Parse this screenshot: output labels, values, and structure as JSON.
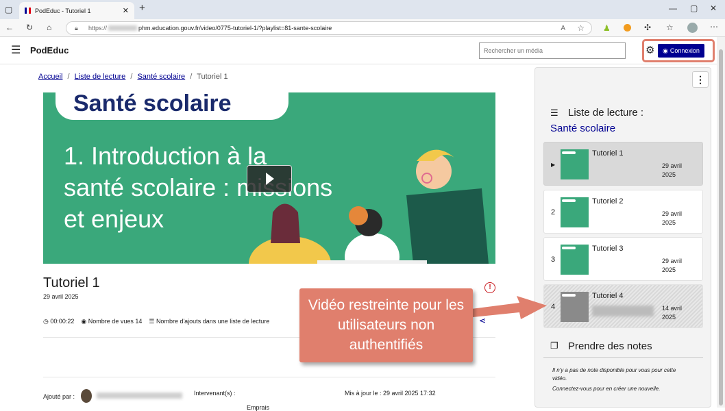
{
  "browser": {
    "tab_title": "PodEduc - Tutoriel 1",
    "url_prefix": "https://",
    "url_main": "phm.education.gouv.fr/video/0775-tutoriel-1/?playlist=81-sante-scolaire"
  },
  "header": {
    "logo": "PodEduc",
    "search_placeholder": "Rechercher un média",
    "login_label": "Connexion"
  },
  "breadcrumb": {
    "home": "Accueil",
    "playlists": "Liste de lecture",
    "playlist": "Santé scolaire",
    "current": "Tutoriel 1"
  },
  "video_slide": {
    "badge": "Santé scolaire",
    "line1": "1. Introduction à la",
    "line2": "santé scolaire : missions",
    "line3": "et enjeux"
  },
  "video": {
    "title": "Tutoriel 1",
    "date": "29 avril 2025",
    "duration": "00:00:22",
    "views": "Nombre de vues 14",
    "playlist_adds": "Nombre d'ajouts dans une liste de lecture"
  },
  "details": {
    "added_by_label": "Ajouté par :",
    "speakers_label": "Intervenant(s) :",
    "updated": "Mis à jour le : 29 avril 2025 17:32",
    "extra": "Emprais"
  },
  "sidebar": {
    "playlist_label": "Liste de lecture :",
    "playlist_name": "Santé scolaire",
    "items": [
      {
        "num": "",
        "title": "Tutoriel 1",
        "date1": "29 avril",
        "date2": "2025"
      },
      {
        "num": "2",
        "title": "Tutoriel 2",
        "date1": "29 avril",
        "date2": "2025"
      },
      {
        "num": "3",
        "title": "Tutoriel 3",
        "date1": "29 avril",
        "date2": "2025"
      },
      {
        "num": "4",
        "title": "Tutoriel 4",
        "date1": "14 avril",
        "date2": "2025"
      }
    ],
    "notes_title": "Prendre des notes",
    "notes_empty": "Il n'y a pas de note disponible pour vous pour cette vidéo.",
    "notes_login": "Connectez-vous pour en créer une nouvelle."
  },
  "callout": {
    "text": "Vidéo restreinte pour les utilisateurs non authentifiés"
  },
  "colors": {
    "brand": "#000091",
    "slide_green": "#3aa87b",
    "callout": "#e07f6d"
  }
}
